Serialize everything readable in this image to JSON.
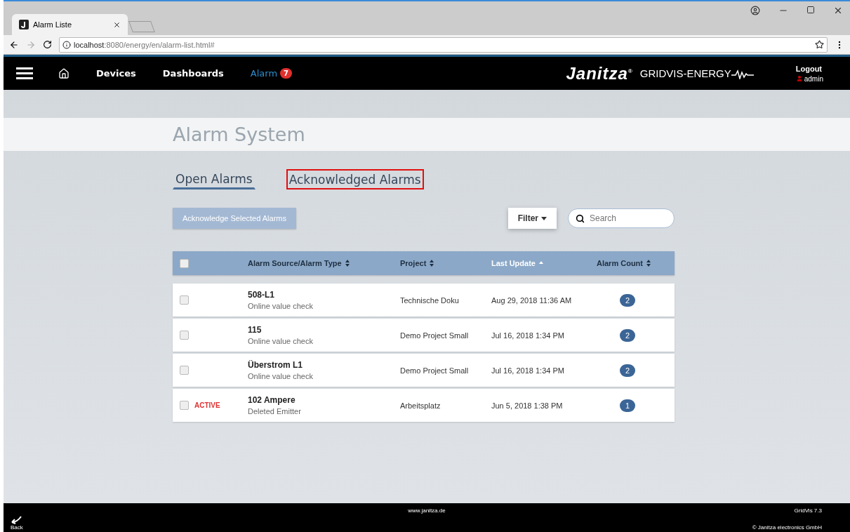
{
  "browser": {
    "tab_title": "Alarm Liste",
    "url_host": "localhost",
    "url_rest": ":8080/energy/en/alarm-list.html#"
  },
  "nav": {
    "items": [
      {
        "label": "Devices",
        "selected": false
      },
      {
        "label": "Dashboards",
        "selected": false
      },
      {
        "label": "Alarm",
        "selected": true,
        "badge": "7"
      }
    ],
    "brand": "Janitza",
    "brand_mark": "®",
    "product": "GRIDVIS-ENERGY",
    "logout": "Logout",
    "user": "admin"
  },
  "page_title": "Alarm System",
  "tabs": [
    {
      "label": "Open Alarms",
      "selected": true,
      "highlighted": false
    },
    {
      "label": "Acknowledged Alarms",
      "selected": false,
      "highlighted": true
    }
  ],
  "acknowledge_button": {
    "label": "Acknowledge Selected Alarms",
    "disabled": true
  },
  "filter_button": "Filter",
  "search": {
    "placeholder": "Search"
  },
  "table": {
    "all_checked": false,
    "columns": [
      {
        "label": "Alarm Source/Alarm Type",
        "sorted": false
      },
      {
        "label": "Project",
        "sorted": false
      },
      {
        "label": "Last Update",
        "sorted": true
      },
      {
        "label": "Alarm Count",
        "sorted": false
      }
    ],
    "rows": [
      {
        "checked": false,
        "source": "508-L1",
        "type": "Online value check",
        "project": "Technische Doku",
        "updated": "Aug 29, 2018 11:36 AM",
        "count": "2"
      },
      {
        "checked": false,
        "source": "115",
        "type": "Online value check",
        "project": "Demo Project Small",
        "updated": "Jul 16, 2018 1:34 PM",
        "count": "2"
      },
      {
        "checked": false,
        "source": "Überstrom L1",
        "type": "Online value check",
        "project": "Demo Project Small",
        "updated": "Jul 16, 2018 1:34 PM",
        "count": "2"
      },
      {
        "checked": false,
        "status": "ACTIVE",
        "source": "102 Ampere",
        "type": "Deleted Emitter",
        "project": "Arbeitsplatz",
        "updated": "Jun 5, 2018 1:38 PM",
        "count": "1"
      }
    ]
  },
  "footer": {
    "back": "Back",
    "site": "www.janitza.de",
    "version": "GridVis 7.3",
    "copyright": "© Janitza electronics GmbH"
  }
}
